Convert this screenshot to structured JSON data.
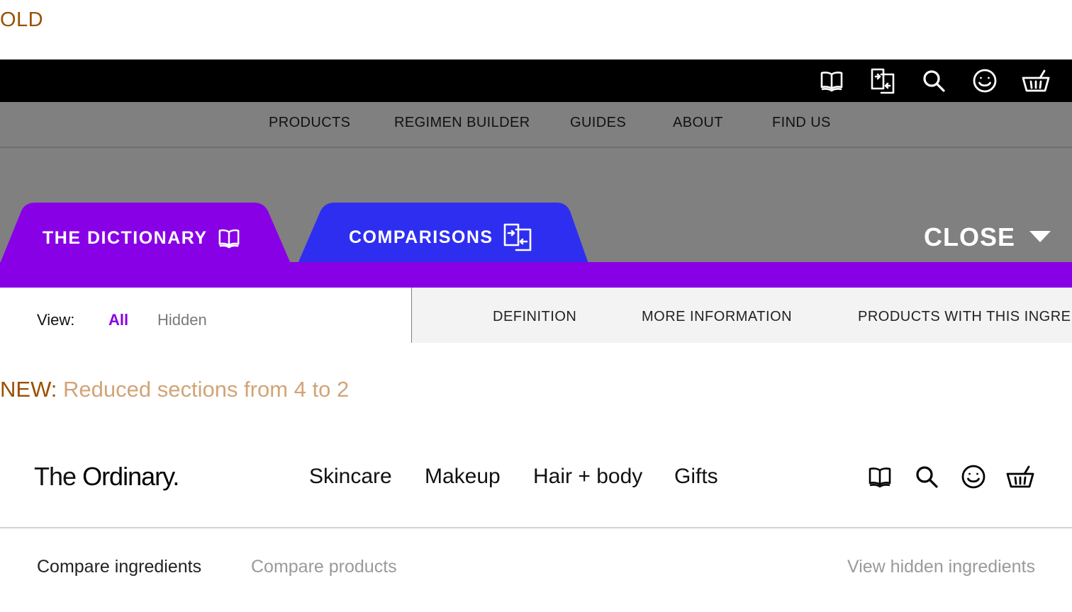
{
  "labels": {
    "old": "OLD",
    "new_key": "NEW:",
    "new_text": "Reduced sections from 4 to 2"
  },
  "old_design": {
    "top_icons": [
      "dictionary-icon",
      "compare-icon",
      "search-icon",
      "account-icon",
      "basket-icon"
    ],
    "nav": [
      "PRODUCTS",
      "REGIMEN BUILDER",
      "GUIDES",
      "ABOUT",
      "FIND US"
    ],
    "tabs": {
      "dictionary": "THE DICTIONARY",
      "comparisons": "COMPARISONS",
      "close": "CLOSE"
    },
    "view": {
      "label": "View:",
      "all": "All",
      "hidden": "Hidden"
    },
    "sections": [
      "DEFINITION",
      "MORE INFORMATION",
      "PRODUCTS WITH THIS INGREDIENT"
    ],
    "colors": {
      "dictionary_tab": "#8800e6",
      "comparisons_tab": "#2e2ef0",
      "nav_bg": "#808080",
      "active_view": "#8800e6"
    }
  },
  "new_design": {
    "logo_light": "The",
    "logo_bold": "Ordinary.",
    "nav": [
      "Skincare",
      "Makeup",
      "Hair + body",
      "Gifts"
    ],
    "icons": [
      "dictionary-icon",
      "search-icon",
      "account-icon",
      "basket-icon"
    ],
    "subnav": {
      "compare_ingredients": "Compare ingredients",
      "compare_products": "Compare products",
      "view_hidden": "View hidden ingredients"
    }
  }
}
